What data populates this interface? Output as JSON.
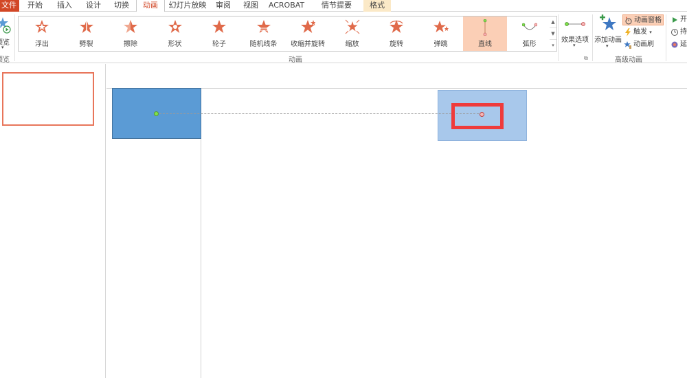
{
  "tabs": [
    {
      "label": "文件",
      "state": "file"
    },
    {
      "label": "开始",
      "state": ""
    },
    {
      "label": "插入",
      "state": ""
    },
    {
      "label": "设计",
      "state": ""
    },
    {
      "label": "切换",
      "state": ""
    },
    {
      "label": "动画",
      "state": "active"
    },
    {
      "label": "幻灯片放映",
      "state": ""
    },
    {
      "label": "审阅",
      "state": ""
    },
    {
      "label": "视图",
      "state": ""
    },
    {
      "label": "ACROBAT",
      "state": ""
    },
    {
      "label": "情节提要",
      "state": ""
    },
    {
      "label": "格式",
      "state": "ctx"
    }
  ],
  "ribbon": {
    "preview": {
      "label": "预览",
      "group": "预览"
    },
    "gallery_items": [
      {
        "label": "浮出",
        "icon": "float-in-star-icon"
      },
      {
        "label": "劈裂",
        "icon": "split-star-icon"
      },
      {
        "label": "擦除",
        "icon": "wipe-star-icon"
      },
      {
        "label": "形状",
        "icon": "shape-star-icon"
      },
      {
        "label": "轮子",
        "icon": "wheel-star-icon"
      },
      {
        "label": "随机线条",
        "icon": "random-bars-star-icon"
      },
      {
        "label": "收缩并旋转",
        "icon": "shrink-turn-star-icon"
      },
      {
        "label": "缩放",
        "icon": "zoom-star-icon"
      },
      {
        "label": "旋转",
        "icon": "swivel-star-icon"
      },
      {
        "label": "弹跳",
        "icon": "bounce-star-icon"
      },
      {
        "label": "直线",
        "icon": "line-path-icon",
        "selected": true
      },
      {
        "label": "弧形",
        "icon": "arc-path-icon"
      }
    ],
    "animation_group_label": "动画",
    "effect_options_label": "效果选项",
    "add_animation_label": "添加动画",
    "animation_pane_label": "动画窗格",
    "trigger_label": "触发",
    "animation_painter_label": "动画刷",
    "advanced_group_label": "高级动画",
    "timing": {
      "start_label": "开",
      "duration_label": "持",
      "delay_label": "延"
    }
  },
  "colors": {
    "accent": "#d24726",
    "star_fill": "#e06a4a",
    "shape_blue": "#5b9bd5",
    "shape_ghost": "#a8c8eb",
    "highlight_red": "#ef3b3b"
  }
}
